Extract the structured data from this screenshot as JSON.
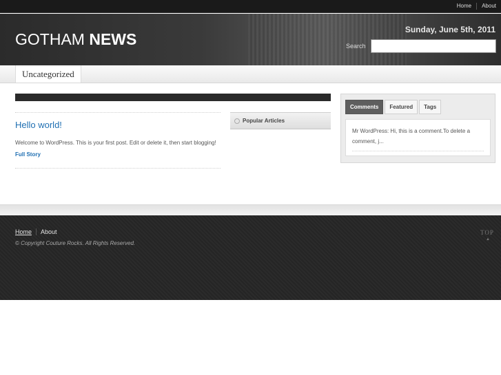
{
  "topnav": {
    "home": "Home",
    "about": "About"
  },
  "header": {
    "logo_light": "GOTHAM",
    "logo_bold": "NEWS",
    "date": "Sunday, June 5th, 2011",
    "search_label": "Search",
    "search_value": ""
  },
  "categories": {
    "item": "Uncategorized"
  },
  "post": {
    "title": "Hello world!",
    "excerpt": "Welcome to WordPress. This is your first post. Edit or delete it, then start blogging!",
    "more": "Full Story"
  },
  "popular": {
    "label": "Popular Articles"
  },
  "sidebar": {
    "tabs": [
      "Comments",
      "Featured",
      "Tags"
    ],
    "comment": "Mr WordPress: Hi, this is a comment.To delete a comment, j..."
  },
  "footer": {
    "home": "Home",
    "about": "About",
    "copyright": "© Copyright Couture Rocks. All Rights Reserved.",
    "top": "TOP"
  }
}
